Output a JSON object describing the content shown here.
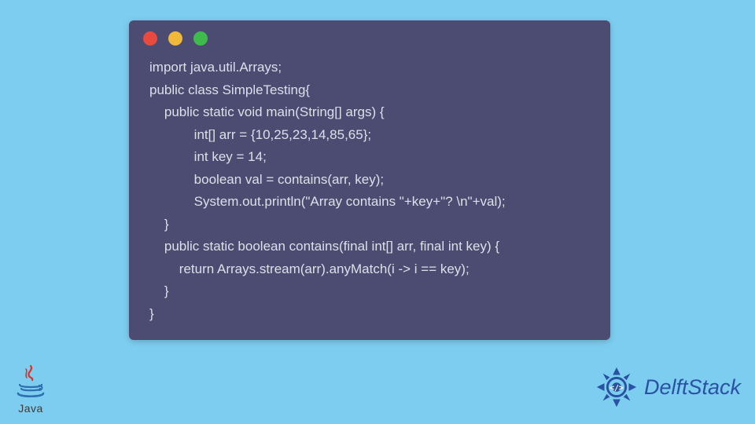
{
  "code": {
    "lines": [
      "import java.util.Arrays;",
      "public class SimpleTesting{",
      "    public static void main(String[] args) {",
      "            int[] arr = {10,25,23,14,85,65};",
      "            int key = 14;",
      "            boolean val = contains(arr, key);",
      "            System.out.println(\"Array contains \"+key+\"? \\n\"+val);",
      "    }",
      "    public static boolean contains(final int[] arr, final int key) {",
      "        return Arrays.stream(arr).anyMatch(i -> i == key);",
      "    }",
      "}"
    ]
  },
  "logos": {
    "java_label": "Java",
    "delft_label": "DelftStack"
  },
  "colors": {
    "background": "#7dcdf0",
    "window": "#4c4c72",
    "code_text": "#dbe0e8",
    "dot_red": "#e94a3f",
    "dot_yellow": "#f0b93a",
    "dot_green": "#3fbb4e",
    "delft_blue": "#2952a3",
    "java_red": "#d8322a"
  }
}
